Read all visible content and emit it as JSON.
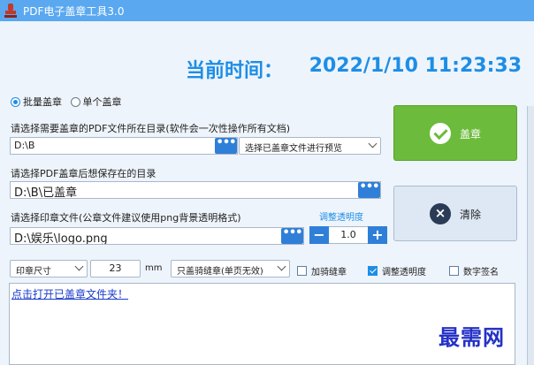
{
  "window": {
    "title": "PDF电子盖章工具3.0"
  },
  "clock": {
    "label": "当前时间：",
    "value": "2022/1/10 11:23:33"
  },
  "mode": {
    "options": [
      {
        "label": "批量盖章",
        "selected": true
      },
      {
        "label": "单个盖章",
        "selected": false
      }
    ]
  },
  "source": {
    "label": "请选择需要盖章的PDF文件所在目录(软件会一次性操作所有文档)",
    "value": "D:\\B",
    "browse_label": "•••",
    "preview_select": "选择已盖章文件进行预览"
  },
  "output": {
    "label": "请选择PDF盖章后想保存在的目录",
    "value": "D:\\B\\已盖章",
    "browse_label": "•••"
  },
  "seal": {
    "label": "请选择印章文件(公章文件建议使用png背景透明格式)",
    "value": "D:\\娱乐\\logo.png",
    "browse_label": "•••"
  },
  "opacity": {
    "title": "调整透明度",
    "value": "1.0",
    "minus": "−",
    "plus": "+"
  },
  "actions": {
    "stamp_label": "盖章",
    "clear_label": "清除",
    "clear_icon": "×"
  },
  "options_row": {
    "size_select": "印章尺寸",
    "size_value": "23",
    "unit": "mm",
    "seam_select": "只盖骑缝章(单页无效)",
    "checkboxes": [
      {
        "label": "加骑缝章",
        "checked": false
      },
      {
        "label": "调整透明度",
        "checked": true
      },
      {
        "label": "数字签名",
        "checked": false
      }
    ]
  },
  "log": {
    "open_folder_link": "点击打开已盖章文件夹！"
  },
  "watermark": "最需网",
  "colors": {
    "titlebar": "#5aa8f0",
    "accent": "#1d8ee6",
    "stamp_button": "#6cbb3c",
    "browse_button": "#2f7fd8"
  }
}
